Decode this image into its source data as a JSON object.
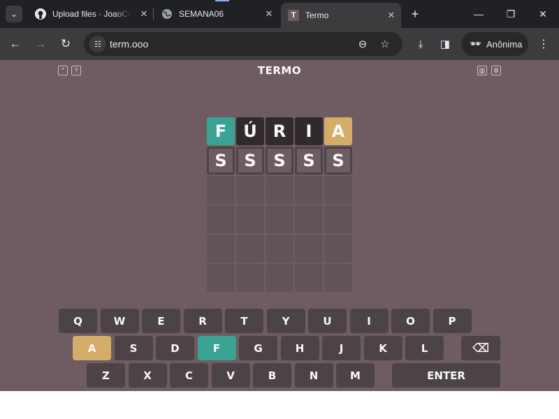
{
  "browser": {
    "tabs": [
      {
        "title": "Upload files · JoaoCh",
        "favicon": "github-icon"
      },
      {
        "title": "SEMANA06",
        "favicon": "globe-icon"
      },
      {
        "title": "Termo",
        "favicon": "T",
        "active": true
      }
    ],
    "url": "term.ooo",
    "profile_label": "Anônima"
  },
  "game": {
    "title": "TERMO",
    "colors": {
      "right": "#3aa394",
      "place": "#d3ad69",
      "wrong": "#312a2c",
      "background": "#6e5c62"
    },
    "board": [
      [
        {
          "letter": "F",
          "state": "right"
        },
        {
          "letter": "Ú",
          "state": "wrong"
        },
        {
          "letter": "R",
          "state": "wrong"
        },
        {
          "letter": "I",
          "state": "wrong"
        },
        {
          "letter": "A",
          "state": "place"
        }
      ],
      [
        {
          "letter": "S",
          "state": "edit"
        },
        {
          "letter": "S",
          "state": "edit"
        },
        {
          "letter": "S",
          "state": "edit"
        },
        {
          "letter": "S",
          "state": "edit"
        },
        {
          "letter": "S",
          "state": "edit"
        }
      ],
      [
        {
          "letter": "",
          "state": "empty"
        },
        {
          "letter": "",
          "state": "empty"
        },
        {
          "letter": "",
          "state": "empty"
        },
        {
          "letter": "",
          "state": "empty"
        },
        {
          "letter": "",
          "state": "empty"
        }
      ],
      [
        {
          "letter": "",
          "state": "empty"
        },
        {
          "letter": "",
          "state": "empty"
        },
        {
          "letter": "",
          "state": "empty"
        },
        {
          "letter": "",
          "state": "empty"
        },
        {
          "letter": "",
          "state": "empty"
        }
      ],
      [
        {
          "letter": "",
          "state": "empty"
        },
        {
          "letter": "",
          "state": "empty"
        },
        {
          "letter": "",
          "state": "empty"
        },
        {
          "letter": "",
          "state": "empty"
        },
        {
          "letter": "",
          "state": "empty"
        }
      ],
      [
        {
          "letter": "",
          "state": "empty"
        },
        {
          "letter": "",
          "state": "empty"
        },
        {
          "letter": "",
          "state": "empty"
        },
        {
          "letter": "",
          "state": "empty"
        },
        {
          "letter": "",
          "state": "empty"
        }
      ]
    ],
    "keyboard": [
      [
        {
          "k": "Q"
        },
        {
          "k": "W"
        },
        {
          "k": "E"
        },
        {
          "k": "R",
          "state": "wrong"
        },
        {
          "k": "T"
        },
        {
          "k": "Y"
        },
        {
          "k": "U",
          "state": "wrong"
        },
        {
          "k": "I",
          "state": "wrong"
        },
        {
          "k": "O"
        },
        {
          "k": "P"
        }
      ],
      [
        {
          "k": "A",
          "state": "place"
        },
        {
          "k": "S"
        },
        {
          "k": "D"
        },
        {
          "k": "F",
          "state": "right"
        },
        {
          "k": "G"
        },
        {
          "k": "H"
        },
        {
          "k": "J"
        },
        {
          "k": "K"
        },
        {
          "k": "L"
        },
        {
          "k": "⌫",
          "name": "backspace"
        }
      ],
      [
        {
          "k": "Z"
        },
        {
          "k": "X"
        },
        {
          "k": "C"
        },
        {
          "k": "V"
        },
        {
          "k": "B"
        },
        {
          "k": "N"
        },
        {
          "k": "M"
        },
        {
          "k": "ENTER",
          "name": "enter"
        }
      ]
    ]
  }
}
